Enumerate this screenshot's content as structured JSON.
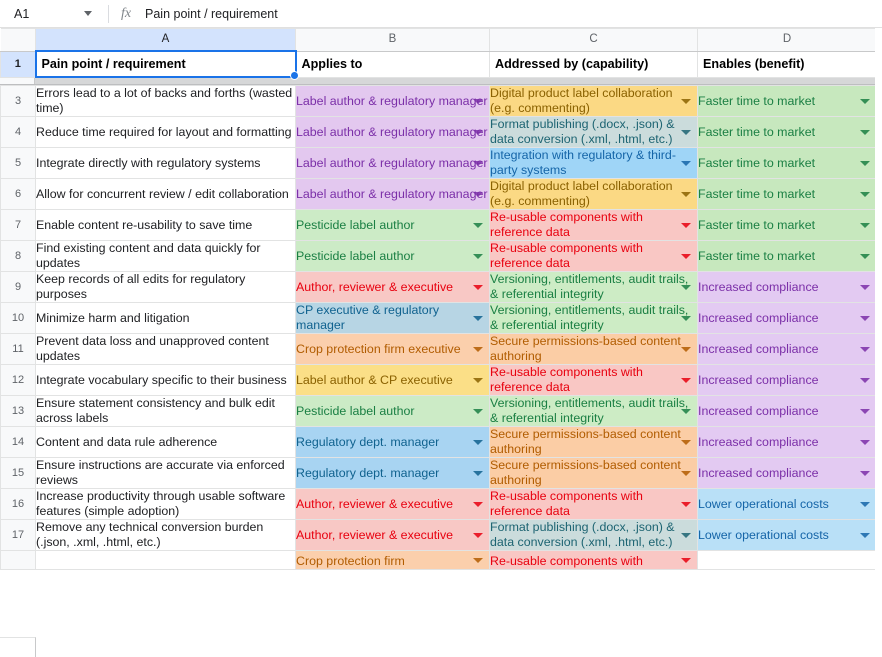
{
  "formula_bar": {
    "name_box_value": "A1",
    "fx_label": "fx",
    "formula_value": "Pain point / requirement"
  },
  "grid": {
    "column_letters": [
      "A",
      "B",
      "C",
      "D"
    ],
    "headers": {
      "a": "Pain point / requirement",
      "b": "Applies to",
      "c": "Addressed by (capability)",
      "d": "Enables (benefit)"
    },
    "header_row_number": "1",
    "rows": [
      {
        "num": "3",
        "a": "Errors lead to a lot of backs and forths (wasted time)",
        "b": "Label author & regulatory manager",
        "c": "Digital product label collaboration (e.g. commenting)",
        "d": "Faster time to market"
      },
      {
        "num": "4",
        "a": "Reduce time required for layout and formatting",
        "b": "Label author & regulatory manager",
        "c": "Format publishing (.docx, .json) & data conversion (.xml, .html, etc.)",
        "d": "Faster time to market"
      },
      {
        "num": "5",
        "a": "Integrate directly with regulatory systems",
        "b": "Label author & regulatory manager",
        "c": "Integration with regulatory & third-party systems",
        "d": "Faster time to market"
      },
      {
        "num": "6",
        "a": "Allow for concurrent review / edit collaboration",
        "b": "Label author & regulatory manager",
        "c": "Digital product label collaboration (e.g. commenting)",
        "d": "Faster time to market"
      },
      {
        "num": "7",
        "a": "Enable content re-usability to save time",
        "b": "Pesticide label author",
        "c": "Re-usable components with reference data",
        "d": "Faster time to market"
      },
      {
        "num": "8",
        "a": "Find existing content and data quickly for updates",
        "b": "Pesticide label author",
        "c": "Re-usable components with reference data",
        "d": "Faster time to market"
      },
      {
        "num": "9",
        "a": "Keep records of all edits for regulatory purposes",
        "b": "Author, reviewer & executive",
        "c": "Versioning, entitlements, audit trails, & referential integrity",
        "d": "Increased compliance"
      },
      {
        "num": "10",
        "a": "Minimize harm and litigation",
        "b": "CP executive & regulatory manager",
        "c": "Versioning, entitlements, audit trails, & referential integrity",
        "d": "Increased compliance"
      },
      {
        "num": "11",
        "a": "Prevent data loss and unapproved content updates",
        "b": "Crop protection firm executive",
        "c": "Secure permissions-based content authoring",
        "d": "Increased compliance"
      },
      {
        "num": "12",
        "a": "Integrate vocabulary specific to their business",
        "b": "Label author & CP executive",
        "c": "Re-usable components with reference data",
        "d": "Increased compliance"
      },
      {
        "num": "13",
        "a": "Ensure statement consistency and bulk edit across labels",
        "b": "Pesticide label author",
        "c": "Versioning, entitlements, audit trails, & referential integrity",
        "d": "Increased compliance"
      },
      {
        "num": "14",
        "a": "Content and data rule adherence",
        "b": "Regulatory dept. manager",
        "c": "Secure permissions-based content authoring",
        "d": "Increased compliance"
      },
      {
        "num": "15",
        "a": "Ensure instructions are accurate via enforced reviews",
        "b": "Regulatory dept. manager",
        "c": "Secure permissions-based content authoring",
        "d": "Increased compliance"
      },
      {
        "num": "16",
        "a": "Increase productivity through usable software features (simple adoption)",
        "b": "Author, reviewer & executive",
        "c": "Re-usable components with reference data",
        "d": "Lower operational costs"
      },
      {
        "num": "17",
        "a": "Remove any technical conversion burden (.json, .xml, .html, etc.)",
        "b": "Author, reviewer & executive",
        "c": "Format publishing (.docx, .json) & data conversion (.xml, .html, etc.)",
        "d": "Lower operational costs"
      },
      {
        "num": "",
        "a": "",
        "b": "Crop protection firm",
        "c": "Re-usable components with",
        "d": ""
      }
    ]
  },
  "colors": {
    "selection_blue": "#1a73e8",
    "header_select_fill": "#d3e3fd",
    "gridline": "#e2e3e3",
    "gutter_fill": "#f8f9fa",
    "freeze_band": "#d6d7d8",
    "purple_chip_bg": "#e3c8ef",
    "purple_chip_fg": "#7b2fa8",
    "green_chip_bg": "#ccebc6",
    "green_chip_fg": "#1a7f43",
    "red_chip_bg": "#f8c8c5",
    "red_chip_fg": "#e8000f",
    "steel_chip_bg": "#b7d5e4",
    "steel_chip_fg": "#10628f",
    "orange_chip_bg": "#fbcfac",
    "orange_chip_fg": "#b15c00",
    "yellow_chip_bg": "#fbdf87",
    "yellow_chip_fg": "#8a6100",
    "blue_chip_bg": "#a8d4f2",
    "blue_chip_fg": "#1565a8"
  }
}
